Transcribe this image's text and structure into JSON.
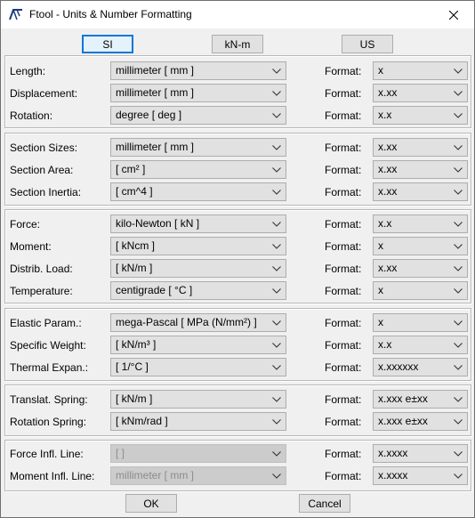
{
  "window": {
    "title": "Ftool - Units & Number Formatting"
  },
  "unit_systems": [
    {
      "label": "SI",
      "selected": true
    },
    {
      "label": "kN-m",
      "selected": false
    },
    {
      "label": "US",
      "selected": false
    }
  ],
  "format_label": "Format:",
  "groups": [
    {
      "rows": [
        {
          "label": "Length:",
          "unit": "millimeter [ mm ]",
          "format": "x"
        },
        {
          "label": "Displacement:",
          "unit": "millimeter [ mm ]",
          "format": "x.xx"
        },
        {
          "label": "Rotation:",
          "unit": "degree [ deg ]",
          "format": "x.x"
        }
      ]
    },
    {
      "rows": [
        {
          "label": "Section Sizes:",
          "unit": "millimeter [ mm ]",
          "format": "x.xx"
        },
        {
          "label": "Section Area:",
          "unit": "[ cm² ]",
          "format": "x.xx"
        },
        {
          "label": "Section Inertia:",
          "unit": "[ cm^4 ]",
          "format": "x.xx"
        }
      ]
    },
    {
      "rows": [
        {
          "label": "Force:",
          "unit": "kilo-Newton [ kN ]",
          "format": "x.x"
        },
        {
          "label": "Moment:",
          "unit": "[ kNcm ]",
          "format": "x"
        },
        {
          "label": "Distrib. Load:",
          "unit": "[ kN/m ]",
          "format": "x.xx"
        },
        {
          "label": "Temperature:",
          "unit": "centigrade [ °C ]",
          "format": "x"
        }
      ]
    },
    {
      "rows": [
        {
          "label": "Elastic Param.:",
          "unit": "mega-Pascal [ MPa (N/mm²) ]",
          "format": "x"
        },
        {
          "label": "Specific Weight:",
          "unit": "[ kN/m³ ]",
          "format": "x.x"
        },
        {
          "label": "Thermal Expan.:",
          "unit": "[ 1/°C ]",
          "format": "x.xxxxxx"
        }
      ]
    },
    {
      "rows": [
        {
          "label": "Translat. Spring:",
          "unit": "[ kN/m ]",
          "format": "x.xxx e±xx"
        },
        {
          "label": "Rotation Spring:",
          "unit": "[ kNm/rad ]",
          "format": "x.xxx e±xx"
        }
      ]
    },
    {
      "rows": [
        {
          "label": "Force Infl. Line:",
          "unit": "[ ]",
          "format": "x.xxxx",
          "unit_disabled": true
        },
        {
          "label": "Moment Infl. Line:",
          "unit": "millimeter [ mm ]",
          "format": "x.xxxx",
          "unit_disabled": true
        }
      ]
    }
  ],
  "buttons": {
    "ok": "OK",
    "cancel": "Cancel"
  },
  "colors": {
    "accent": "#0078d7",
    "button_face": "#e1e1e1",
    "window_bg": "#f0f0f0"
  }
}
